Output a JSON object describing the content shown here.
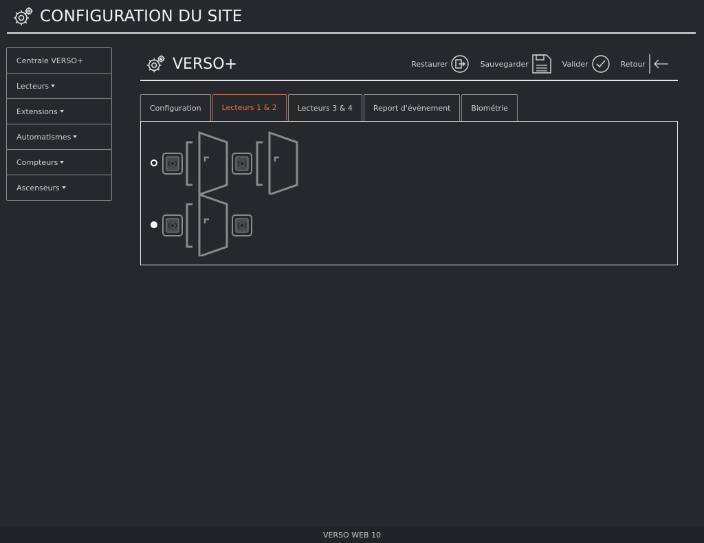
{
  "app": {
    "title": "CONFIGURATION DU SITE",
    "footer": "VERSO WEB 10"
  },
  "sidebar": {
    "items": [
      {
        "label": "Centrale VERSO+",
        "has_caret": false
      },
      {
        "label": "Lecteurs",
        "has_caret": true
      },
      {
        "label": "Extensions",
        "has_caret": true
      },
      {
        "label": "Automatismes",
        "has_caret": true
      },
      {
        "label": "Compteurs",
        "has_caret": true
      },
      {
        "label": "Ascenseurs",
        "has_caret": true
      }
    ]
  },
  "main": {
    "title": "VERSO+",
    "toolbar": {
      "restore": "Restaurer",
      "save": "Sauvegarder",
      "validate": "Valider",
      "back": "Retour"
    },
    "tabs": [
      {
        "label": "Configuration",
        "active": false
      },
      {
        "label": "Lecteurs 1 & 2",
        "active": true
      },
      {
        "label": "Lecteurs 3 & 4",
        "active": false
      },
      {
        "label": "Report d'évènement",
        "active": false
      },
      {
        "label": "Biométrie",
        "active": false
      }
    ],
    "options": [
      {
        "selected": false,
        "layout": "two-doors"
      },
      {
        "selected": true,
        "layout": "one-door-two-readers"
      }
    ]
  },
  "colors": {
    "accent": "#e05a3a",
    "background": "#27282c",
    "line": "#e6e6e6"
  }
}
